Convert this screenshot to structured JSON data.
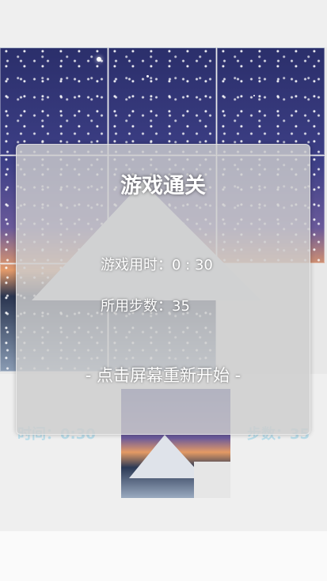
{
  "game": {
    "board": {
      "tiles": [
        {
          "label": "tile-1"
        },
        {
          "label": "tile-2"
        },
        {
          "label": "tile-3"
        },
        {
          "label": "tile-4"
        },
        {
          "label": "tile-5"
        },
        {
          "label": "tile-6"
        },
        {
          "label": "tile-7"
        },
        {
          "label": "tile-8"
        }
      ],
      "empty_tile_index": 8
    },
    "hud": {
      "time_label": "时间：0:30",
      "steps_label": "步数：35"
    }
  },
  "result_overlay": {
    "title": "游戏通关",
    "time_used": "游戏用时：0 : 30",
    "steps_used": "所用步数：35",
    "restart_hint": "- 点击屏幕重新开始 -"
  },
  "colors": {
    "overlay_bg": "#cdcdcd",
    "hud_text": "#8fd0e6"
  }
}
